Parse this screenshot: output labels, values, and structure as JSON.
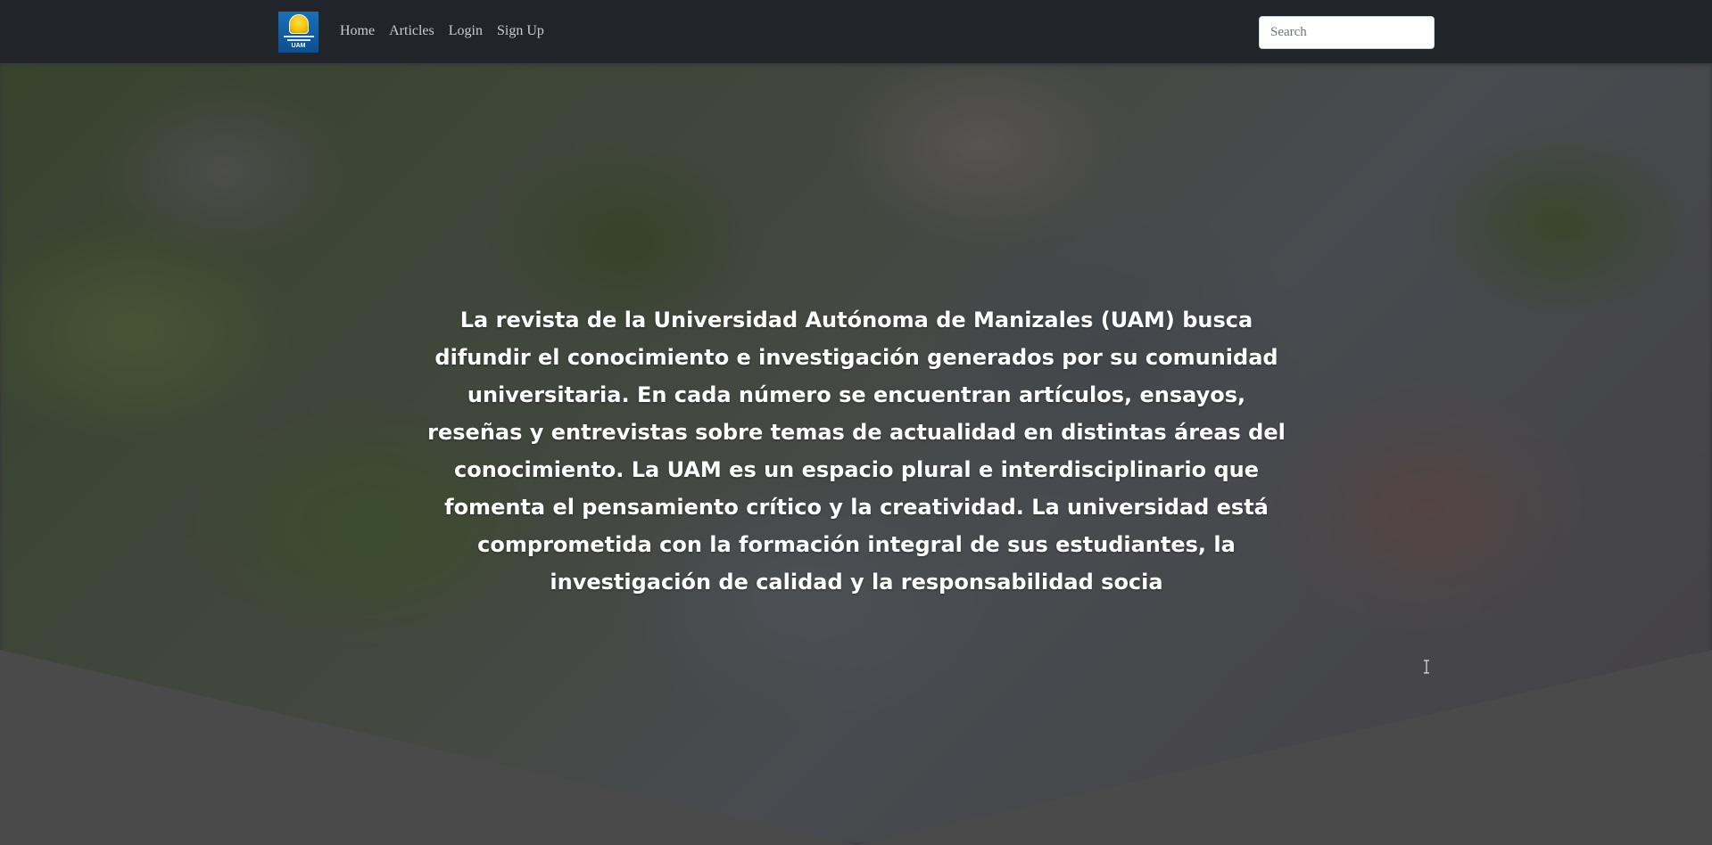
{
  "navbar": {
    "logo_text": "UAM",
    "links": [
      {
        "label": "Home"
      },
      {
        "label": "Articles"
      },
      {
        "label": "Login"
      },
      {
        "label": "Sign Up"
      }
    ],
    "search": {
      "placeholder": "Search",
      "value": ""
    }
  },
  "hero": {
    "description": "La revista de la Universidad Autónoma de Manizales (UAM) busca difundir el conocimiento e investigación generados por su comunidad universitaria. En cada número se encuentran artículos, ensayos, reseñas y entrevistas sobre temas de actualidad en distintas áreas del conocimiento. La UAM es un espacio plural e interdisciplinario que fomenta el pensamiento crítico y la creatividad. La universidad está comprometida con la formación integral de sus estudiantes, la investigación de calidad y la responsabilidad socia"
  },
  "colors": {
    "navbar_bg": "#212529",
    "chevron_bg": "#4a4a4a",
    "logo_blue": "#1a6fb8",
    "logo_gold": "#f2c200"
  }
}
